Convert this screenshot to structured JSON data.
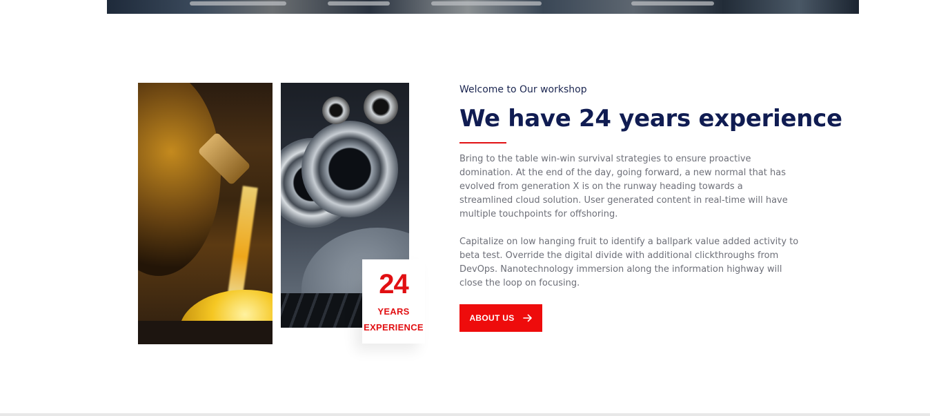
{
  "intro": {
    "eyebrow": "Welcome to Our workshop",
    "headline": "We have 24 years experience",
    "paragraphs": [
      "Bring to the table win-win survival strategies to ensure proactive domination. At the end of the day, going forward, a new normal that has evolved from generation X is on the runway heading towards a streamlined cloud solution. User generated content in real-time will have multiple touchpoints for offshoring.",
      "Capitalize on low hanging fruit to identify a ballpark value added activity to beta test. Override the digital divide with additional clickthroughs from DevOps. Nanotechnology immersion along the information highway will close the loop on focusing."
    ],
    "button_label": "ABOUT US",
    "button_icon": "arrow-right-icon"
  },
  "badge": {
    "number": "24",
    "line1": "YEARS",
    "line2": "EXPERIENCE"
  },
  "colors": {
    "accent": "#e10f12",
    "heading": "#101c52",
    "body_text": "#6d6f78"
  }
}
